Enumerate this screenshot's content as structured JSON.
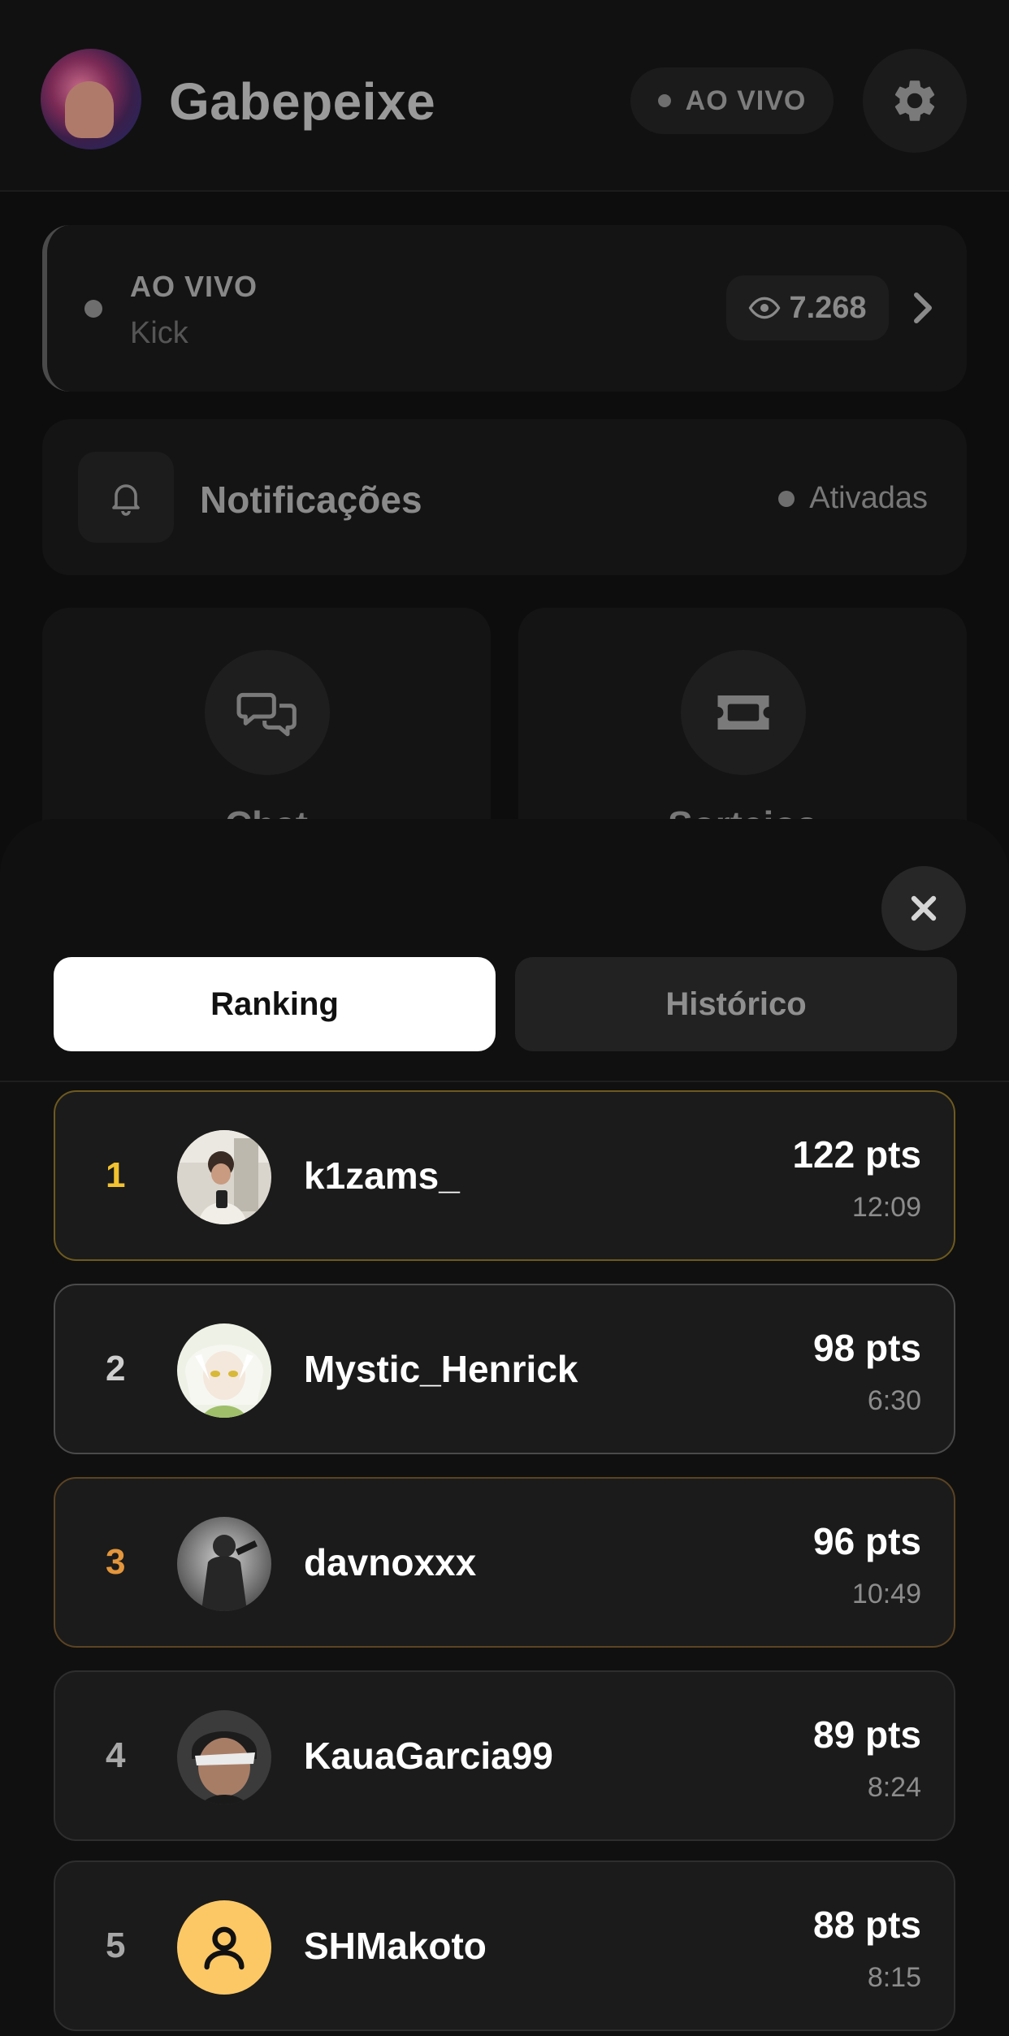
{
  "header": {
    "channel_name": "Gabepeixe",
    "live_badge": "AO VIVO",
    "icons": {
      "settings": "gear-icon"
    }
  },
  "live_card": {
    "status": "AO VIVO",
    "platform": "Kick",
    "viewers": "7.268",
    "icons": {
      "viewers": "eye-icon",
      "open": "chevron-right-icon"
    }
  },
  "notifications": {
    "label": "Notificações",
    "status": "Ativadas",
    "icon": "bell-icon"
  },
  "tiles": [
    {
      "label": "Chat",
      "icon": "chat-bubbles-icon"
    },
    {
      "label": "Sorteios",
      "icon": "ticket-icon"
    }
  ],
  "sheet": {
    "tabs": [
      {
        "label": "Ranking",
        "active": true
      },
      {
        "label": "Histórico",
        "active": false
      }
    ],
    "ranking": [
      {
        "position": "1",
        "username": "k1zams_",
        "points": "122 pts",
        "time": "12:09",
        "tier": "gold"
      },
      {
        "position": "2",
        "username": "Mystic_Henrick",
        "points": "98 pts",
        "time": "6:30",
        "tier": "silver"
      },
      {
        "position": "3",
        "username": "davnoxxx",
        "points": "96 pts",
        "time": "10:49",
        "tier": "bronze"
      },
      {
        "position": "4",
        "username": "KauaGarcia99",
        "points": "89 pts",
        "time": "8:24",
        "tier": "none"
      },
      {
        "position": "5",
        "username": "SHMakoto",
        "points": "88 pts",
        "time": "8:15",
        "tier": "none"
      }
    ]
  },
  "colors": {
    "gold": "#f2c230",
    "silver": "#cfcfcf",
    "bronze": "#e3963c",
    "default_avatar_bg": "#fcc866"
  }
}
